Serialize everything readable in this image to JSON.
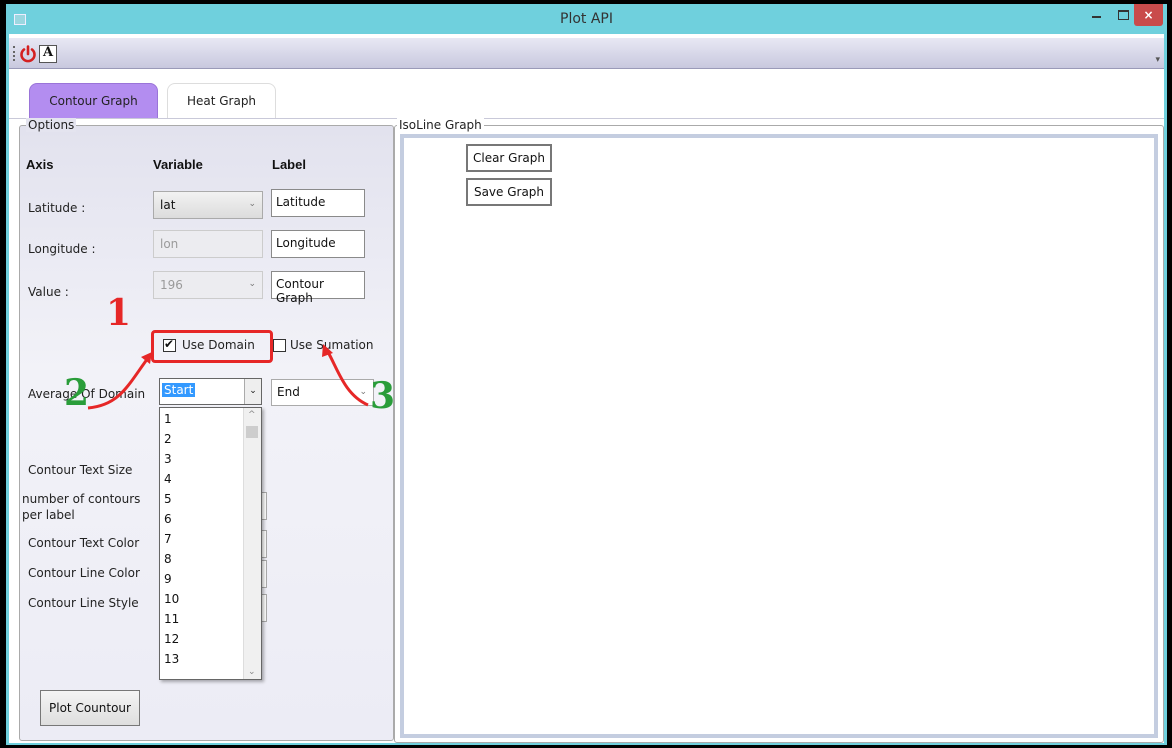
{
  "window": {
    "title": "Plot API",
    "close_glyph": "×"
  },
  "toolbar": {
    "icons": [
      "power-icon",
      "font-icon"
    ],
    "font_icon_glyph": "A"
  },
  "tabs": [
    {
      "label": "Contour Graph",
      "active": true
    },
    {
      "label": "Heat Graph",
      "active": false
    }
  ],
  "options": {
    "group_label": "Options",
    "headers": {
      "axis": "Axis",
      "variable": "Variable",
      "label": "Label"
    },
    "latitude": {
      "label": "Latitude :",
      "variable": "lat",
      "text": "Latitude"
    },
    "longitude": {
      "label": "Longitude :",
      "variable": "lon",
      "text": "Longitude"
    },
    "value": {
      "label": "Value :",
      "variable": "196",
      "text": "Contour Graph"
    },
    "use_domain": {
      "label": "Use Domain",
      "checked": true
    },
    "use_sumation": {
      "label": "Use Sumation",
      "checked": false
    },
    "average_of_domain": {
      "label": "Average Of Domain",
      "start": "Start",
      "end": "End"
    },
    "dropdown_items": [
      "1",
      "2",
      "3",
      "4",
      "5",
      "6",
      "7",
      "8",
      "9",
      "10",
      "11",
      "12",
      "13"
    ],
    "contour_text_size": "Contour Text Size",
    "contours_per_label": "number of contours per label",
    "contour_text_color": "Contour Text Color",
    "contour_line_color": "Contour Line Color",
    "contour_line_style": "Contour Line Style",
    "plot_button": "Plot Countour"
  },
  "isoline": {
    "group_label": "IsoLine Graph",
    "clear_button": "Clear Graph",
    "save_button": "Save Graph"
  },
  "annotations": {
    "one": "1",
    "two": "2",
    "three": "3",
    "red": "#e62727",
    "green": "#2a9d3a"
  }
}
